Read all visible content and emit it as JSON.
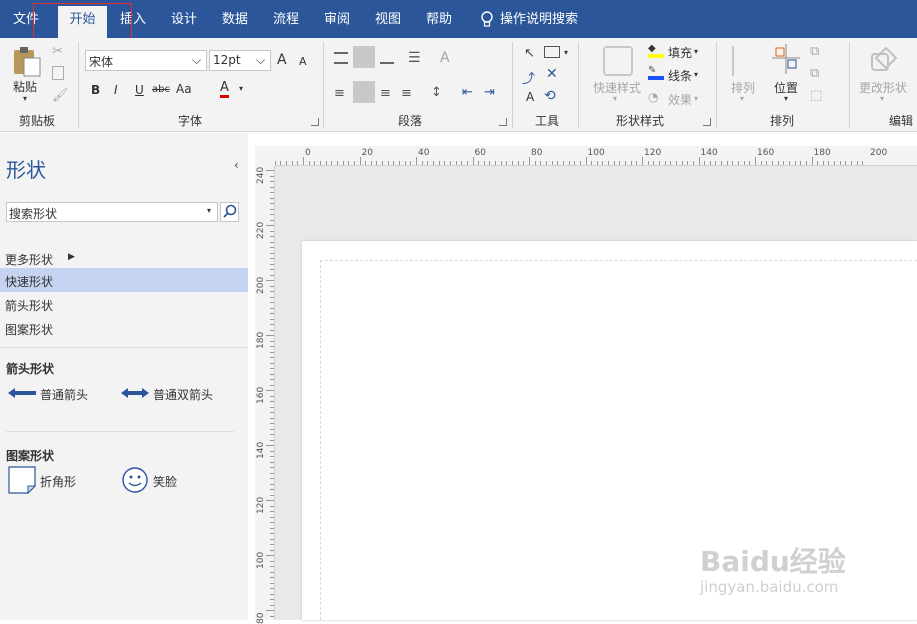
{
  "tabs": [
    "文件",
    "开始",
    "插入",
    "设计",
    "数据",
    "流程",
    "审阅",
    "视图",
    "帮助"
  ],
  "tell_me": "操作说明搜索",
  "clipboard": {
    "paste": "粘贴",
    "group": "剪贴板"
  },
  "font": {
    "name": "宋体",
    "size": "12pt",
    "bold": "B",
    "italic": "I",
    "underline": "U",
    "strike": "abc",
    "case": "Aa",
    "color": "A",
    "grow": "A",
    "shrink": "A",
    "group": "字体"
  },
  "paragraph": {
    "group": "段落"
  },
  "tools": {
    "group": "工具",
    "text": "A"
  },
  "shape_styles": {
    "quick": "快速样式",
    "fill": "填充",
    "line": "线条",
    "effects": "效果",
    "group": "形状样式"
  },
  "arrange": {
    "align": "排列",
    "position": "位置",
    "group": "排列"
  },
  "editing": {
    "change_shape": "更改形状",
    "group": "编辑"
  },
  "panel": {
    "title": "形状",
    "search_placeholder": "搜索形状",
    "nav": [
      "更多形状",
      "快速形状",
      "箭头形状",
      "图案形状"
    ],
    "arrow_section": "箭头形状",
    "arrow_shapes": [
      "普通箭头",
      "普通双箭头"
    ],
    "pattern_section": "图案形状",
    "pattern_shapes": [
      "折角形",
      "笑脸"
    ]
  },
  "ruler_top": [
    "0",
    "20",
    "40",
    "60",
    "80",
    "100",
    "120",
    "140",
    "160",
    "180",
    "200"
  ],
  "ruler_left": [
    "240",
    "220",
    "200",
    "180",
    "160",
    "140",
    "120",
    "100",
    "80"
  ],
  "watermark": {
    "main": "Baidu经验",
    "sub": "jingyan.baidu.com"
  },
  "colors": {
    "brand": "#2b579a",
    "highlight": "#c5d3f0",
    "annotation": "#e03030",
    "fill_swatch": "#ffff00",
    "line_swatch": "#1c52ff",
    "font_color": "#e00000"
  }
}
